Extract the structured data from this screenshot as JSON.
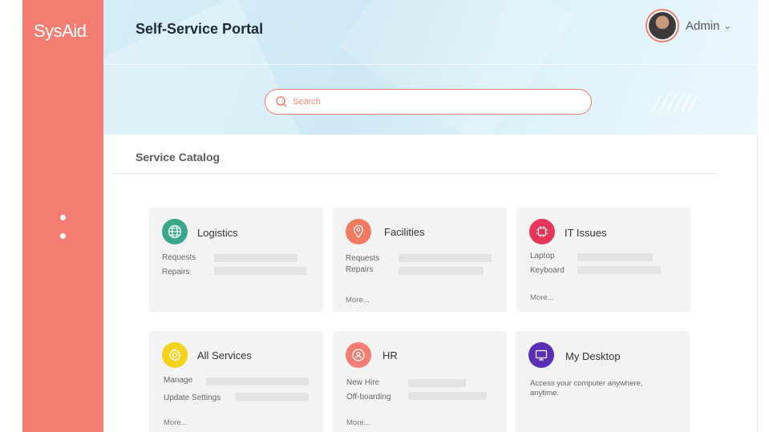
{
  "brand": {
    "logo_text": "SysAid",
    "logo_dot": "."
  },
  "header": {
    "title": "Self-Service Portal",
    "user_name": "Admin",
    "decoration": "//////"
  },
  "search": {
    "placeholder": "Search"
  },
  "catalog": {
    "title": "Service Catalog",
    "cards": [
      {
        "title": "Logistics",
        "icon": "globe-icon",
        "color": "#3aa68a",
        "rows": [
          "Requests",
          "Repairs"
        ],
        "more": ""
      },
      {
        "title": "Facilities",
        "icon": "location-pin-icon",
        "color": "#f27a5e",
        "rows": [
          "Requests",
          "Repairs"
        ],
        "more": "More..."
      },
      {
        "title": "IT Issues",
        "icon": "chip-icon",
        "color": "#e8355a",
        "rows": [
          "Laptop",
          "Keyboard"
        ],
        "more": "More..."
      },
      {
        "title": "All Services",
        "icon": "gear-icon",
        "color": "#f2d21b",
        "rows": [
          "Manage",
          "Update Settings"
        ],
        "more": "More..."
      },
      {
        "title": "HR",
        "icon": "person-search-icon",
        "color": "#f47d73",
        "rows": [
          "New Hire",
          "Off-boarding"
        ],
        "more": "More..."
      },
      {
        "title": "My Desktop",
        "icon": "monitor-icon",
        "color": "#5b2fb5",
        "description": "Access your computer anywhere, anytime."
      }
    ]
  },
  "colors": {
    "accent": "#f47d73",
    "sidebar": "#f47d73"
  }
}
